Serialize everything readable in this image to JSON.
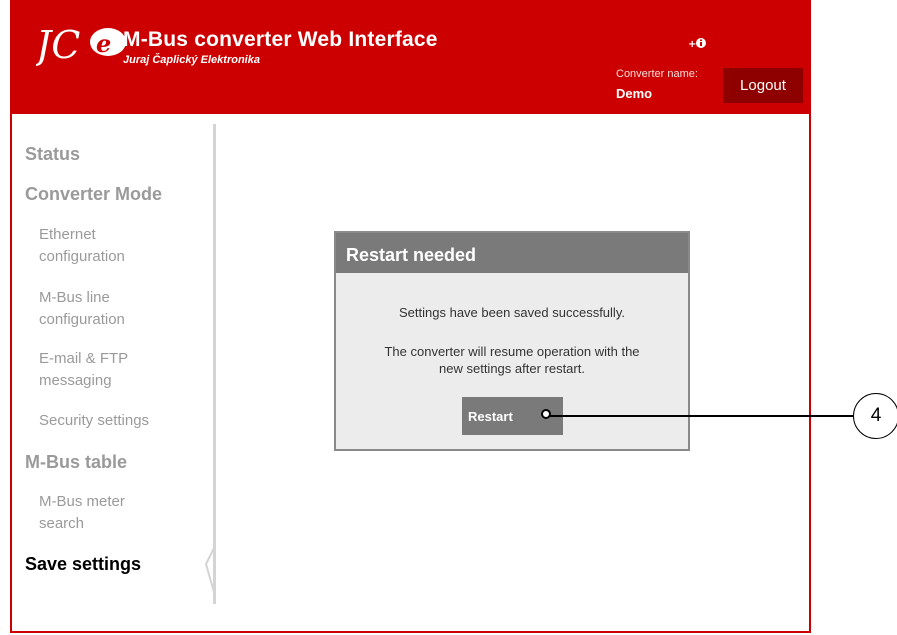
{
  "header": {
    "logo_text": "JC-e",
    "title": "M-Bus converter Web Interface",
    "company": "Juraj Čaplický Elektronika",
    "info_icon": "plus-info-icon",
    "converter_label": "Converter name:",
    "converter_name": "Demo",
    "logout_label": "Logout",
    "brand_color": "#cc0000"
  },
  "sidebar": {
    "items": [
      {
        "label": "Status",
        "level": "main",
        "active": false
      },
      {
        "label": "Converter Mode",
        "level": "main",
        "active": false
      },
      {
        "label": "Ethernet\nconfiguration",
        "level": "sub",
        "active": false
      },
      {
        "label": "M-Bus line\nconfiguration",
        "level": "sub",
        "active": false
      },
      {
        "label": "E-mail & FTP\nmessaging",
        "level": "sub",
        "active": false
      },
      {
        "label": "Security settings",
        "level": "sub",
        "active": false
      },
      {
        "label": "M-Bus table",
        "level": "main",
        "active": false
      },
      {
        "label": "M-Bus meter\nsearch",
        "level": "sub",
        "active": false
      },
      {
        "label": "Save settings",
        "level": "main",
        "active": true
      }
    ]
  },
  "dialog": {
    "title": "Restart needed",
    "message1": "Settings have been saved successfully.",
    "message2": "The converter will resume operation with the new settings after restart.",
    "restart_label": "Restart"
  },
  "callout": {
    "number": "4"
  }
}
